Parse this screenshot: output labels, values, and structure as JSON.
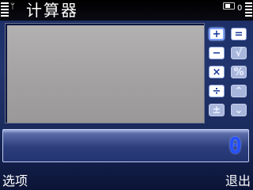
{
  "status_bar": {
    "title": "计算器",
    "antenna_icon": "antenna-icon",
    "battery_count": "0"
  },
  "operators": {
    "plus": "+",
    "equals": "=",
    "minus": "−",
    "sqrt": "√",
    "multiply": "×",
    "percent": "%",
    "divide": "÷",
    "scroll_up": "⌃",
    "plus_minus": "±",
    "scroll_down": "⌄"
  },
  "display": {
    "value": "0"
  },
  "softkeys": {
    "left": "选项",
    "right": "退出"
  },
  "colors": {
    "accent": "#2550ff",
    "background": "#22356e"
  }
}
